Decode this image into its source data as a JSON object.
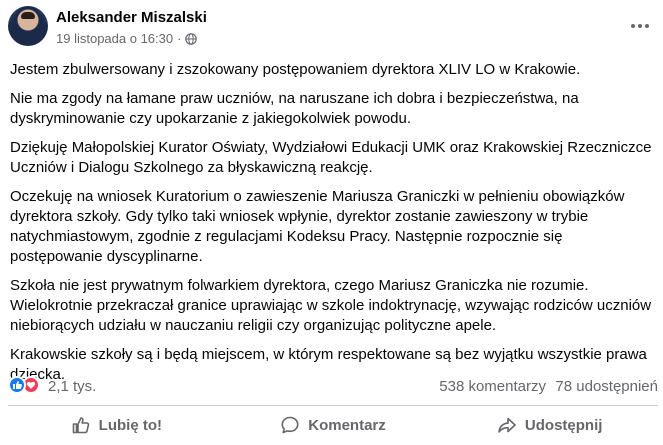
{
  "post": {
    "author": "Aleksander Miszalski",
    "timestamp": "19 listopada o 16:30",
    "separator": "·",
    "paragraphs": [
      "Jestem zbulwersowany i zszokowany postępowaniem dyrektora XLIV LO w Krakowie.",
      "Nie ma zgody na łamane praw uczniów, na naruszane ich dobra i bezpieczeństwa, na dyskryminowanie czy upokarzanie z jakiegokolwiek powodu.",
      "Dziękuję Małopolskiej Kurator Oświaty, Wydziałowi Edukacji UMK oraz Krakowskiej Rzeczniczce Uczniów i Dialogu Szkolnego za błyskawiczną reakcję.",
      "Oczekuję na wniosek Kuratorium o zawieszenie Mariusza Graniczki w pełnieniu obowiązków dyrektora szkoły. Gdy tylko taki wniosek wpłynie, dyrektor zostanie zawieszony w trybie natychmiastowym, zgodnie z regulacjami Kodeksu Pracy. Następnie rozpocznie się postępowanie dyscyplinarne.",
      "Szkoła nie jest prywatnym folwarkiem dyrektora, czego Mariusz Graniczka nie rozumie. Wielokrotnie przekraczał granice uprawiając w szkole indoktrynację, wzywając rodziców uczniów niebiorących udziału w nauczaniu religii czy organizując polityczne apele.",
      "Krakowskie szkoły są i będą miejscem, w którym respektowane są bez wyjątku wszystkie prawa dziecka."
    ]
  },
  "stats": {
    "reactions": "2,1 tys.",
    "comments": "538 komentarzy",
    "shares": "78 udostępnień"
  },
  "actions": {
    "like": "Lubię to!",
    "comment": "Komentarz",
    "share": "Udostępnij"
  },
  "colors": {
    "like_blue": "#1877f2",
    "love_red": "#f33e58",
    "secondary_text": "#65676b"
  }
}
